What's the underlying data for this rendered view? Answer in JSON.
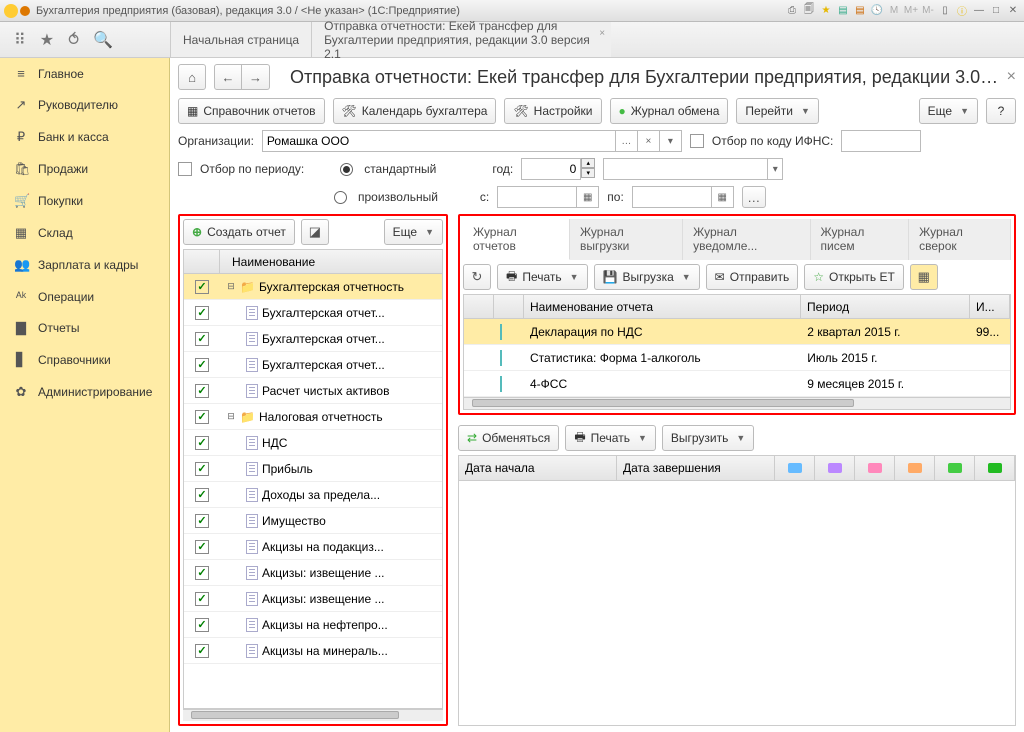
{
  "titlebar": {
    "title": "Бухгалтерия предприятия (базовая), редакция 3.0 / <Не указан>   (1С:Предприятие)"
  },
  "top_tabs": {
    "home": "Начальная страница",
    "active_l1": "Отправка отчетности: Екей трансфер для",
    "active_l2": "Бухгалтерии предприятия, редакции 3.0 версия 2.1"
  },
  "sidebar": [
    {
      "icon": "≡",
      "label": "Главное"
    },
    {
      "icon": "↗",
      "label": "Руководителю"
    },
    {
      "icon": "₽",
      "label": "Банк и касса"
    },
    {
      "icon": "🛍",
      "label": "Продажи"
    },
    {
      "icon": "🛒",
      "label": "Покупки"
    },
    {
      "icon": "▦",
      "label": "Склад"
    },
    {
      "icon": "👥",
      "label": "Зарплата и кадры"
    },
    {
      "icon": "ᴬᵏ",
      "label": "Операции"
    },
    {
      "icon": "▇",
      "label": "Отчеты"
    },
    {
      "icon": "▋",
      "label": "Справочники"
    },
    {
      "icon": "✿",
      "label": "Администрирование"
    }
  ],
  "page": {
    "title": "Отправка отчетности: Екей трансфер для Бухгалтерии предприятия, редакции 3.0 ..."
  },
  "toolbar": {
    "reportsDir": "Справочник отчетов",
    "calendar": "Календарь бухгалтера",
    "settings": "Настройки",
    "journal": "Журнал обмена",
    "goto": "Перейти",
    "more": "Еще",
    "help": "?"
  },
  "filters": {
    "orgLabel": "Организации:",
    "orgValue": "Ромашка ООО",
    "ifnsLabel": "Отбор по коду ИФНС:",
    "periodCheck": "Отбор по периоду:",
    "standard": "стандартный",
    "custom": "произвольный",
    "yearLabel": "год:",
    "yearValue": "0",
    "fromLabel": "с:",
    "toLabel": "по:"
  },
  "left": {
    "create": "Создать отчет",
    "more": "Еще",
    "header": "Наименование",
    "rows": [
      {
        "type": "folder",
        "exp": "⊟",
        "label": "Бухгалтерская отчетность",
        "indent": 0,
        "sel": true
      },
      {
        "type": "doc",
        "label": "Бухгалтерская отчет...",
        "indent": 1
      },
      {
        "type": "doc",
        "label": "Бухгалтерская отчет...",
        "indent": 1
      },
      {
        "type": "doc",
        "label": "Бухгалтерская отчет...",
        "indent": 1
      },
      {
        "type": "doc",
        "label": "Расчет чистых активов",
        "indent": 1
      },
      {
        "type": "folder",
        "exp": "⊟",
        "label": "Налоговая отчетность",
        "indent": 0
      },
      {
        "type": "doc",
        "label": "НДС",
        "indent": 1
      },
      {
        "type": "doc",
        "label": "Прибыль",
        "indent": 1
      },
      {
        "type": "doc",
        "label": "Доходы за предела...",
        "indent": 1
      },
      {
        "type": "doc",
        "label": "Имущество",
        "indent": 1
      },
      {
        "type": "doc",
        "label": "Акцизы на подакциз...",
        "indent": 1
      },
      {
        "type": "doc",
        "label": "Акцизы: извещение ...",
        "indent": 1
      },
      {
        "type": "doc",
        "label": "Акцизы: извещение ...",
        "indent": 1
      },
      {
        "type": "doc",
        "label": "Акцизы на нефтепро...",
        "indent": 1
      },
      {
        "type": "doc",
        "label": "Акцизы на минераль...",
        "indent": 1
      }
    ]
  },
  "right": {
    "tabs": [
      "Журнал отчетов",
      "Журнал выгрузки",
      "Журнал уведомле...",
      "Журнал писем",
      "Журнал сверок"
    ],
    "tb": {
      "print": "Печать",
      "export": "Выгрузка",
      "send": "Отправить",
      "openET": "Открыть ЕТ"
    },
    "hdr": {
      "name": "Наименование отчета",
      "period": "Период",
      "i": "И..."
    },
    "rows": [
      {
        "name": "Декларация по НДС",
        "period": "2 квартал 2015 г.",
        "i": "99...",
        "sel": true
      },
      {
        "name": "Статистика: Форма 1-алкоголь",
        "period": "Июль 2015 г.",
        "i": ""
      },
      {
        "name": "4-ФСС",
        "period": "9 месяцев 2015 г.",
        "i": ""
      }
    ]
  },
  "bottom": {
    "exchange": "Обменяться",
    "print": "Печать",
    "export": "Выгрузить",
    "h1": "Дата начала",
    "h2": "Дата завершения"
  }
}
